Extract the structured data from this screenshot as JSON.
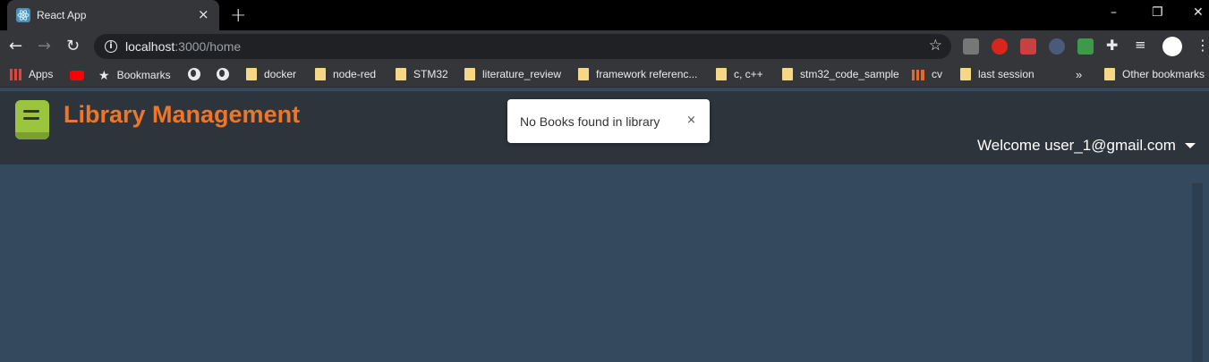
{
  "browser": {
    "tab_title": "React App",
    "tab_close": "×",
    "new_tab": "+",
    "url_host": "localhost",
    "url_path": ":3000/home",
    "window_controls": [
      "–",
      "❐",
      "✕"
    ],
    "bookmarks": [
      {
        "label": "Apps",
        "icon": "apps-icon"
      },
      {
        "label": "",
        "icon": "youtube-icon"
      },
      {
        "label": "Bookmarks",
        "icon": "star-icon"
      },
      {
        "label": "",
        "icon": "globe-icon"
      },
      {
        "label": "",
        "icon": "globe-icon"
      },
      {
        "label": "docker",
        "icon": "folder-icon"
      },
      {
        "label": "node-red",
        "icon": "folder-icon"
      },
      {
        "label": "STM32",
        "icon": "folder-icon"
      },
      {
        "label": "literature_review",
        "icon": "folder-icon"
      },
      {
        "label": "framework referenc...",
        "icon": "folder-icon"
      },
      {
        "label": "c, c++",
        "icon": "folder-icon"
      },
      {
        "label": "stm32_code_sample",
        "icon": "folder-icon"
      },
      {
        "label": "cv",
        "icon": "chart-icon"
      },
      {
        "label": "last session",
        "icon": "folder-icon"
      },
      {
        "label": "»",
        "icon": ""
      },
      {
        "label": "Other bookmarks",
        "icon": "folder-icon"
      }
    ]
  },
  "app": {
    "title": "Library Management",
    "welcome": "Welcome user_1@gmail.com",
    "toast": {
      "message": "No Books found in library",
      "close": "×"
    },
    "colors": {
      "title": "#ee7628",
      "header_bg": "#2d343c",
      "content_bg": "#34495e",
      "logo": "#9bc53d"
    }
  }
}
